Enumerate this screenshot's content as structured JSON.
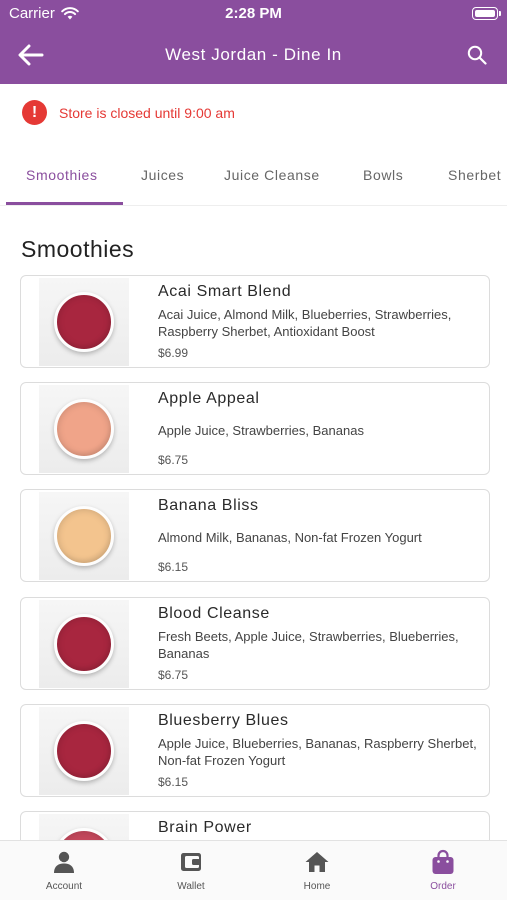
{
  "status_bar": {
    "carrier": "Carrier",
    "time": "2:28 PM"
  },
  "nav": {
    "title": "West Jordan - Dine In"
  },
  "alert": {
    "message": "Store is closed until 9:00 am"
  },
  "tabs": [
    {
      "label": "Smoothies",
      "active": true
    },
    {
      "label": "Juices",
      "active": false
    },
    {
      "label": "Juice Cleanse",
      "active": false
    },
    {
      "label": "Bowls",
      "active": false
    },
    {
      "label": "Sherbet",
      "active": false
    }
  ],
  "section": {
    "title": "Smoothies"
  },
  "products": [
    {
      "name": "Acai Smart Blend",
      "description": "Acai Juice, Almond Milk, Blueberries, Strawberries, Raspberry Sherbet, Antioxidant Boost",
      "price": "$6.99",
      "cup_color": "#a8263f"
    },
    {
      "name": "Apple Appeal",
      "description": "Apple Juice, Strawberries, Bananas",
      "price": "$6.75",
      "cup_color": "#f0a489"
    },
    {
      "name": "Banana Bliss",
      "description": "Almond Milk, Bananas, Non-fat Frozen Yogurt",
      "price": "$6.15",
      "cup_color": "#f3c48e"
    },
    {
      "name": "Blood Cleanse",
      "description": "Fresh Beets, Apple Juice, Strawberries, Blueberries, Bananas",
      "price": "$6.75",
      "cup_color": "#a8263f"
    },
    {
      "name": "Bluesberry Blues",
      "description": "Apple Juice, Blueberries, Bananas, Raspberry Sherbet, Non-fat Frozen Yogurt",
      "price": "$6.15",
      "cup_color": "#a8263f"
    },
    {
      "name": "Brain Power",
      "description": "",
      "price": "",
      "cup_color": "#c4485c"
    }
  ],
  "tabbar": {
    "items": [
      {
        "label": "Account",
        "icon": "person-icon",
        "active": false
      },
      {
        "label": "Wallet",
        "icon": "wallet-icon",
        "active": false
      },
      {
        "label": "Home",
        "icon": "home-icon",
        "active": false
      },
      {
        "label": "Order",
        "icon": "shopping-bag-icon",
        "active": true
      }
    ]
  },
  "colors": {
    "brand": "#8a4e9e",
    "alert": "#e53935"
  }
}
